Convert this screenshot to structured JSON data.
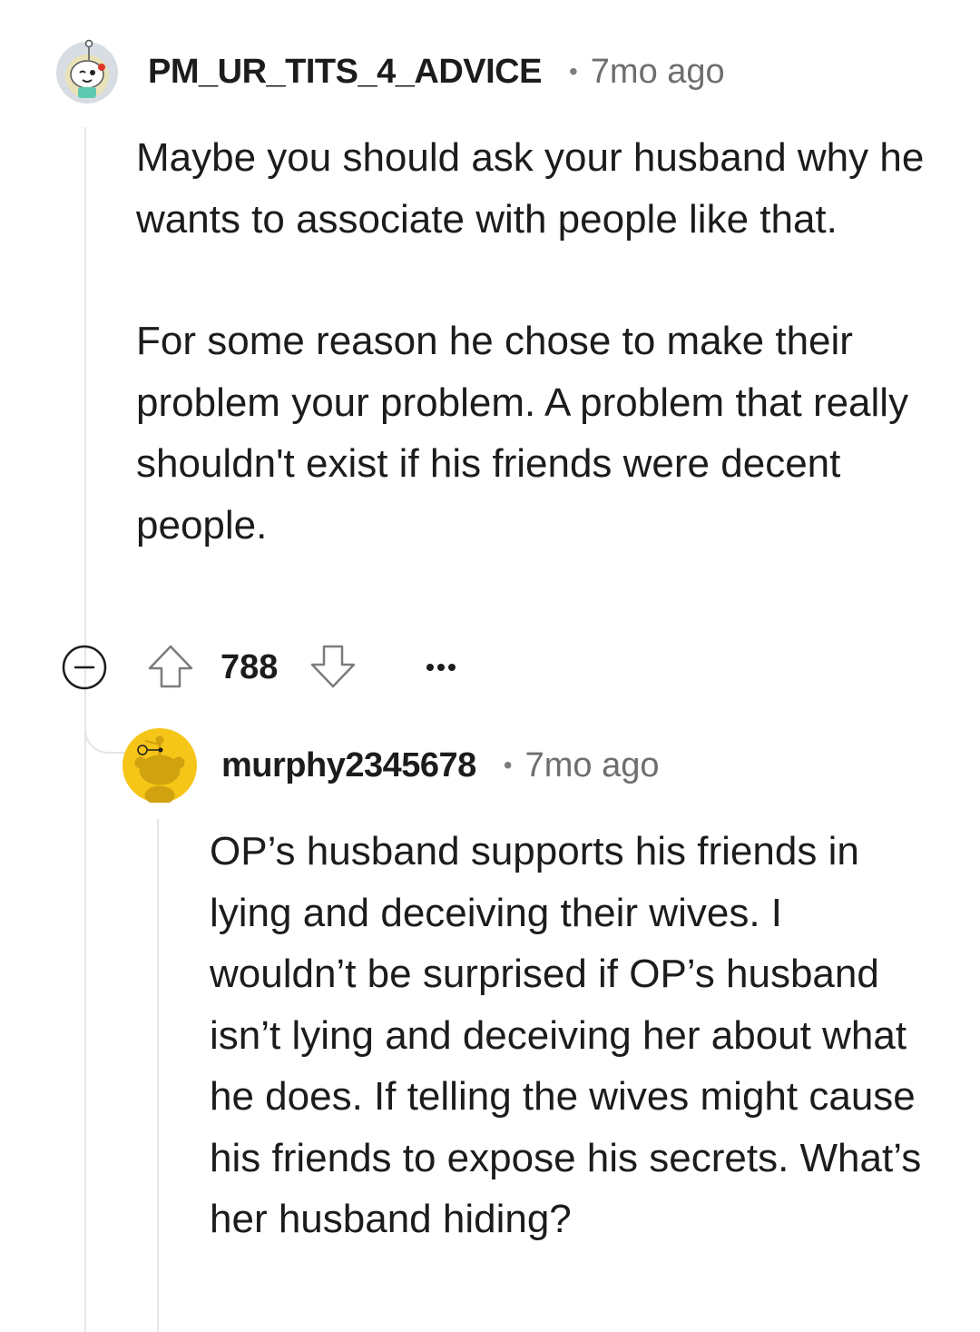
{
  "comment": {
    "author": "PM_UR_TITS_4_ADVICE",
    "separator": "•",
    "time": "7mo ago",
    "paragraphs": [
      "Maybe you should ask your husband why he wants to associate with people like that.",
      "For some reason he chose to make their problem your problem. A problem that really shouldn't exist if his friends were decent people."
    ],
    "score": "788",
    "avatar_icon": "snoo-avatar-icon"
  },
  "reply": {
    "author": "murphy2345678",
    "separator": "•",
    "time": "7mo ago",
    "paragraphs": [
      "OP’s husband supports his friends in lying and deceiving their wives. I wouldn’t be surprised if OP’s husband isn’t lying and deceiving her about what he does. If telling the wives might cause his friends to expose his secrets. What’s her husband hiding?"
    ],
    "avatar_icon": "snoo-avatar-icon",
    "avatar_color": "#F5C518"
  },
  "colors": {
    "text": "#1c1c1c",
    "meta": "#6e6e6e",
    "thread_line": "#e4e6e8",
    "icon_stroke": "#7c7c7c"
  }
}
